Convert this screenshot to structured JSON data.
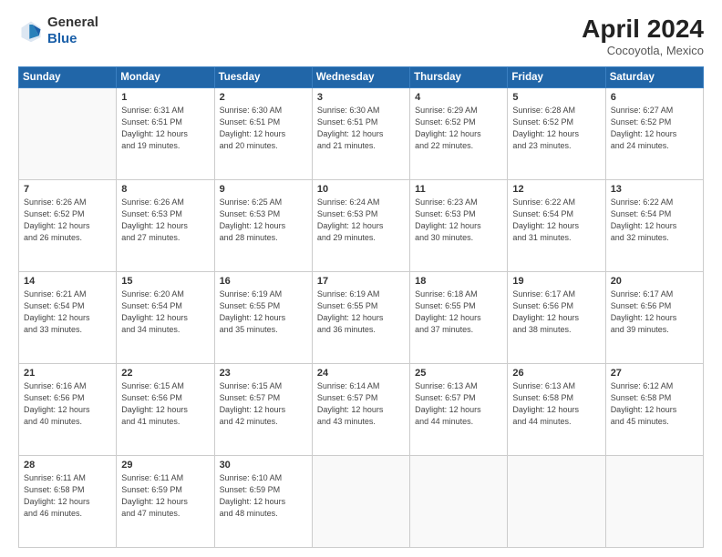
{
  "logo": {
    "line1": "General",
    "line2": "Blue"
  },
  "title": {
    "month_year": "April 2024",
    "location": "Cocoyotla, Mexico"
  },
  "days_of_week": [
    "Sunday",
    "Monday",
    "Tuesday",
    "Wednesday",
    "Thursday",
    "Friday",
    "Saturday"
  ],
  "weeks": [
    [
      {
        "day": "",
        "info": ""
      },
      {
        "day": "1",
        "info": "Sunrise: 6:31 AM\nSunset: 6:51 PM\nDaylight: 12 hours\nand 19 minutes."
      },
      {
        "day": "2",
        "info": "Sunrise: 6:30 AM\nSunset: 6:51 PM\nDaylight: 12 hours\nand 20 minutes."
      },
      {
        "day": "3",
        "info": "Sunrise: 6:30 AM\nSunset: 6:51 PM\nDaylight: 12 hours\nand 21 minutes."
      },
      {
        "day": "4",
        "info": "Sunrise: 6:29 AM\nSunset: 6:52 PM\nDaylight: 12 hours\nand 22 minutes."
      },
      {
        "day": "5",
        "info": "Sunrise: 6:28 AM\nSunset: 6:52 PM\nDaylight: 12 hours\nand 23 minutes."
      },
      {
        "day": "6",
        "info": "Sunrise: 6:27 AM\nSunset: 6:52 PM\nDaylight: 12 hours\nand 24 minutes."
      }
    ],
    [
      {
        "day": "7",
        "info": "Sunrise: 6:26 AM\nSunset: 6:52 PM\nDaylight: 12 hours\nand 26 minutes."
      },
      {
        "day": "8",
        "info": "Sunrise: 6:26 AM\nSunset: 6:53 PM\nDaylight: 12 hours\nand 27 minutes."
      },
      {
        "day": "9",
        "info": "Sunrise: 6:25 AM\nSunset: 6:53 PM\nDaylight: 12 hours\nand 28 minutes."
      },
      {
        "day": "10",
        "info": "Sunrise: 6:24 AM\nSunset: 6:53 PM\nDaylight: 12 hours\nand 29 minutes."
      },
      {
        "day": "11",
        "info": "Sunrise: 6:23 AM\nSunset: 6:53 PM\nDaylight: 12 hours\nand 30 minutes."
      },
      {
        "day": "12",
        "info": "Sunrise: 6:22 AM\nSunset: 6:54 PM\nDaylight: 12 hours\nand 31 minutes."
      },
      {
        "day": "13",
        "info": "Sunrise: 6:22 AM\nSunset: 6:54 PM\nDaylight: 12 hours\nand 32 minutes."
      }
    ],
    [
      {
        "day": "14",
        "info": "Sunrise: 6:21 AM\nSunset: 6:54 PM\nDaylight: 12 hours\nand 33 minutes."
      },
      {
        "day": "15",
        "info": "Sunrise: 6:20 AM\nSunset: 6:54 PM\nDaylight: 12 hours\nand 34 minutes."
      },
      {
        "day": "16",
        "info": "Sunrise: 6:19 AM\nSunset: 6:55 PM\nDaylight: 12 hours\nand 35 minutes."
      },
      {
        "day": "17",
        "info": "Sunrise: 6:19 AM\nSunset: 6:55 PM\nDaylight: 12 hours\nand 36 minutes."
      },
      {
        "day": "18",
        "info": "Sunrise: 6:18 AM\nSunset: 6:55 PM\nDaylight: 12 hours\nand 37 minutes."
      },
      {
        "day": "19",
        "info": "Sunrise: 6:17 AM\nSunset: 6:56 PM\nDaylight: 12 hours\nand 38 minutes."
      },
      {
        "day": "20",
        "info": "Sunrise: 6:17 AM\nSunset: 6:56 PM\nDaylight: 12 hours\nand 39 minutes."
      }
    ],
    [
      {
        "day": "21",
        "info": "Sunrise: 6:16 AM\nSunset: 6:56 PM\nDaylight: 12 hours\nand 40 minutes."
      },
      {
        "day": "22",
        "info": "Sunrise: 6:15 AM\nSunset: 6:56 PM\nDaylight: 12 hours\nand 41 minutes."
      },
      {
        "day": "23",
        "info": "Sunrise: 6:15 AM\nSunset: 6:57 PM\nDaylight: 12 hours\nand 42 minutes."
      },
      {
        "day": "24",
        "info": "Sunrise: 6:14 AM\nSunset: 6:57 PM\nDaylight: 12 hours\nand 43 minutes."
      },
      {
        "day": "25",
        "info": "Sunrise: 6:13 AM\nSunset: 6:57 PM\nDaylight: 12 hours\nand 44 minutes."
      },
      {
        "day": "26",
        "info": "Sunrise: 6:13 AM\nSunset: 6:58 PM\nDaylight: 12 hours\nand 44 minutes."
      },
      {
        "day": "27",
        "info": "Sunrise: 6:12 AM\nSunset: 6:58 PM\nDaylight: 12 hours\nand 45 minutes."
      }
    ],
    [
      {
        "day": "28",
        "info": "Sunrise: 6:11 AM\nSunset: 6:58 PM\nDaylight: 12 hours\nand 46 minutes."
      },
      {
        "day": "29",
        "info": "Sunrise: 6:11 AM\nSunset: 6:59 PM\nDaylight: 12 hours\nand 47 minutes."
      },
      {
        "day": "30",
        "info": "Sunrise: 6:10 AM\nSunset: 6:59 PM\nDaylight: 12 hours\nand 48 minutes."
      },
      {
        "day": "",
        "info": ""
      },
      {
        "day": "",
        "info": ""
      },
      {
        "day": "",
        "info": ""
      },
      {
        "day": "",
        "info": ""
      }
    ]
  ]
}
